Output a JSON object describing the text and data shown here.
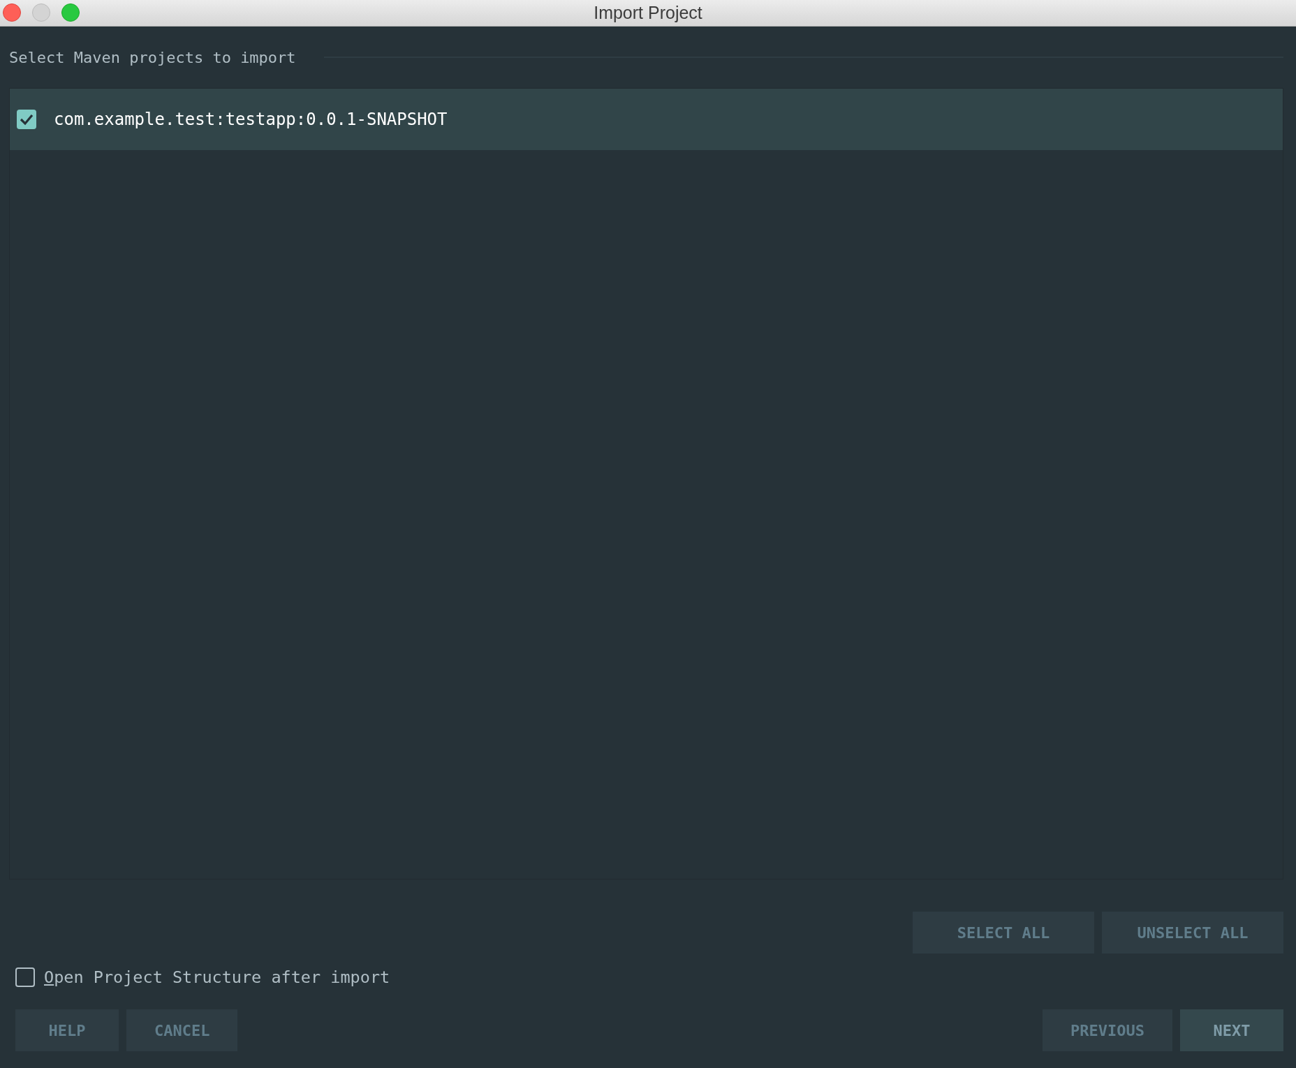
{
  "window": {
    "title": "Import Project"
  },
  "section_title": "Select Maven projects to import",
  "projects": [
    {
      "name": "com.example.test:testapp:0.0.1-SNAPSHOT",
      "checked": true,
      "selected": true
    }
  ],
  "list_buttons": [
    {
      "label": "SELECT ALL"
    },
    {
      "label": "UNSELECT ALL"
    }
  ],
  "open_structure": {
    "label": "Open Project Structure after import",
    "checked": false,
    "mnemonic_underlined": true
  },
  "left_buttons": [
    {
      "label": "HELP",
      "default": false
    },
    {
      "label": "CANCEL",
      "default": false
    }
  ],
  "right_buttons": [
    {
      "label": "PREVIOUS",
      "default": false
    },
    {
      "label": "NEXT",
      "default": true
    }
  ]
}
